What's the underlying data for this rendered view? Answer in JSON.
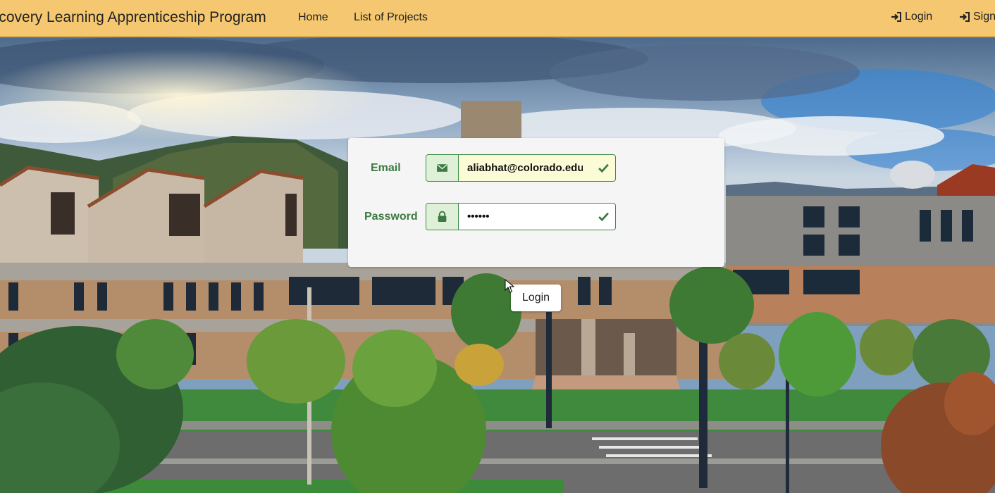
{
  "navbar": {
    "brand": "Discovery Learning Apprenticeship Program",
    "links": [
      "Home",
      "List of Projects"
    ],
    "login_label": "Login",
    "signup_label": "Sign Up",
    "login_icon": "sign-in-icon",
    "signup_icon": "sign-in-icon"
  },
  "login_form": {
    "email_label": "Email",
    "email_value": "aliabhat@colorado.edu",
    "email_icon": "envelope-icon",
    "password_label": "Password",
    "password_value": "secret",
    "password_icon": "lock-icon",
    "valid_icon": "checkmark-icon"
  },
  "login_button": "Login",
  "colors": {
    "navbar": "#f5c770",
    "success_green": "#3c7a43",
    "addon_bg": "#dff0d8",
    "autofill_bg": "#fbfbd6"
  }
}
